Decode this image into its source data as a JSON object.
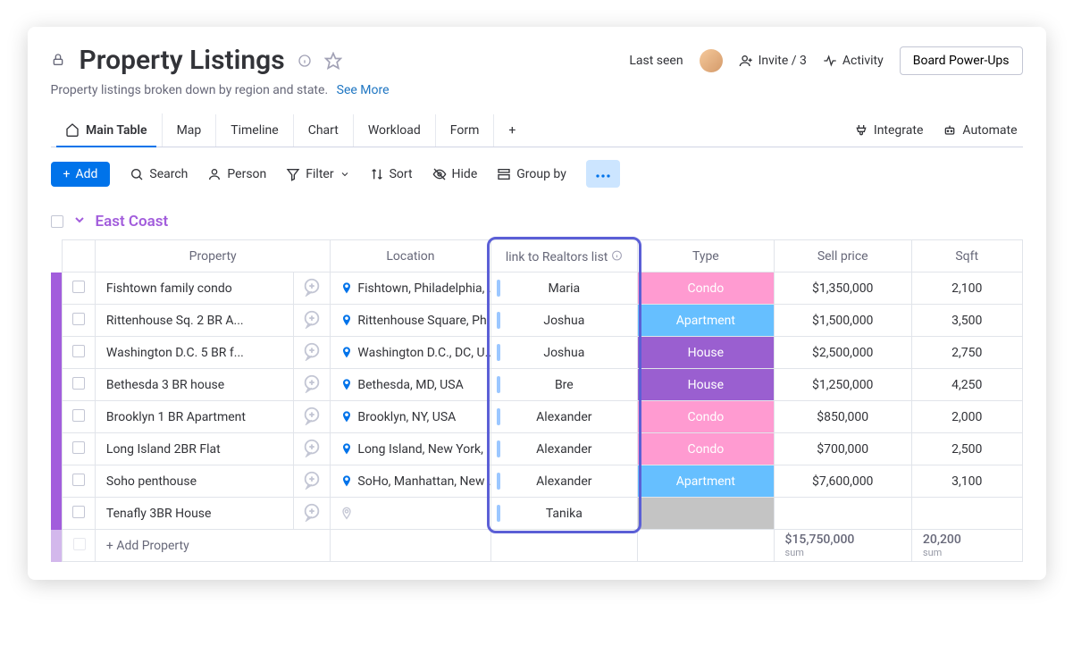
{
  "header": {
    "title": "Property Listings",
    "subtitle": "Property listings broken down by region and state.",
    "see_more": "See More",
    "last_seen": "Last seen",
    "invite": "Invite / 3",
    "activity": "Activity",
    "powerups": "Board Power-Ups"
  },
  "tabs": {
    "items": [
      "Main Table",
      "Map",
      "Timeline",
      "Chart",
      "Workload",
      "Form"
    ],
    "integrate": "Integrate",
    "automate": "Automate"
  },
  "tools": {
    "add": "Add",
    "search": "Search",
    "person": "Person",
    "filter": "Filter",
    "sort": "Sort",
    "hide": "Hide",
    "groupby": "Group by"
  },
  "group": {
    "name": "East Coast"
  },
  "columns": {
    "property": "Property",
    "location": "Location",
    "realtor": "link to Realtors list",
    "type": "Type",
    "price": "Sell price",
    "sqft": "Sqft"
  },
  "rows": [
    {
      "property": "Fishtown family condo",
      "location": "Fishtown, Philadelphia, ...",
      "realtor": "Maria",
      "type": "Condo",
      "type_class": "t-condo",
      "price": "$1,350,000",
      "sqft": "2,100"
    },
    {
      "property": "Rittenhouse Sq. 2 BR A...",
      "location": "Rittenhouse Square, Ph...",
      "realtor": "Joshua",
      "type": "Apartment",
      "type_class": "t-apt",
      "price": "$1,500,000",
      "sqft": "3,500"
    },
    {
      "property": "Washington D.C. 5 BR f...",
      "location": "Washington D.C., DC, U...",
      "realtor": "Joshua",
      "type": "House",
      "type_class": "t-house",
      "price": "$2,500,000",
      "sqft": "2,750"
    },
    {
      "property": "Bethesda 3 BR house",
      "location": "Bethesda, MD, USA",
      "realtor": "Bre",
      "type": "House",
      "type_class": "t-house",
      "price": "$1,250,000",
      "sqft": "4,250"
    },
    {
      "property": "Brooklyn 1 BR Apartment",
      "location": "Brooklyn, NY, USA",
      "realtor": "Alexander",
      "type": "Condo",
      "type_class": "t-condo",
      "price": "$850,000",
      "sqft": "2,000"
    },
    {
      "property": "Long Island 2BR Flat",
      "location": "Long Island, New York, ...",
      "realtor": "Alexander",
      "type": "Condo",
      "type_class": "t-condo",
      "price": "$700,000",
      "sqft": "2,500"
    },
    {
      "property": "Soho penthouse",
      "location": "SoHo, Manhattan, New ...",
      "realtor": "Alexander",
      "type": "Apartment",
      "type_class": "t-apt",
      "price": "$7,600,000",
      "sqft": "3,100"
    },
    {
      "property": "Tenafly 3BR House",
      "location": "",
      "realtor": "Tanika",
      "type": "",
      "type_class": "t-empty",
      "price": "",
      "sqft": ""
    }
  ],
  "footer": {
    "add_property": "+ Add Property",
    "price_sum": "$15,750,000",
    "sqft_sum": "20,200",
    "sum_label": "sum"
  }
}
